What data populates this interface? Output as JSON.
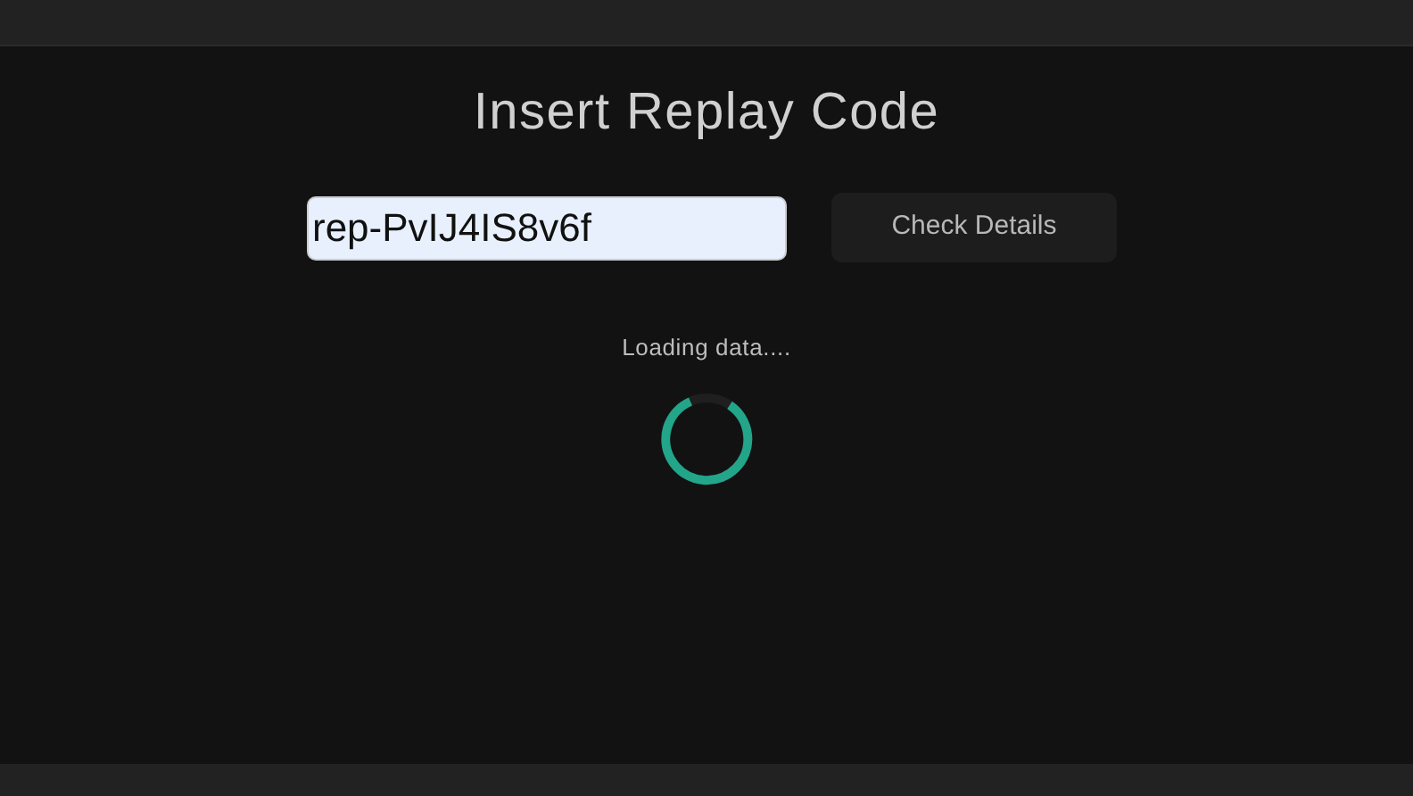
{
  "title": "Insert Replay Code",
  "replay_code_field": {
    "value": "rep-PvIJ4IS8v6f"
  },
  "check_button": {
    "label": "Check Details"
  },
  "status": {
    "text": "Loading data...."
  }
}
